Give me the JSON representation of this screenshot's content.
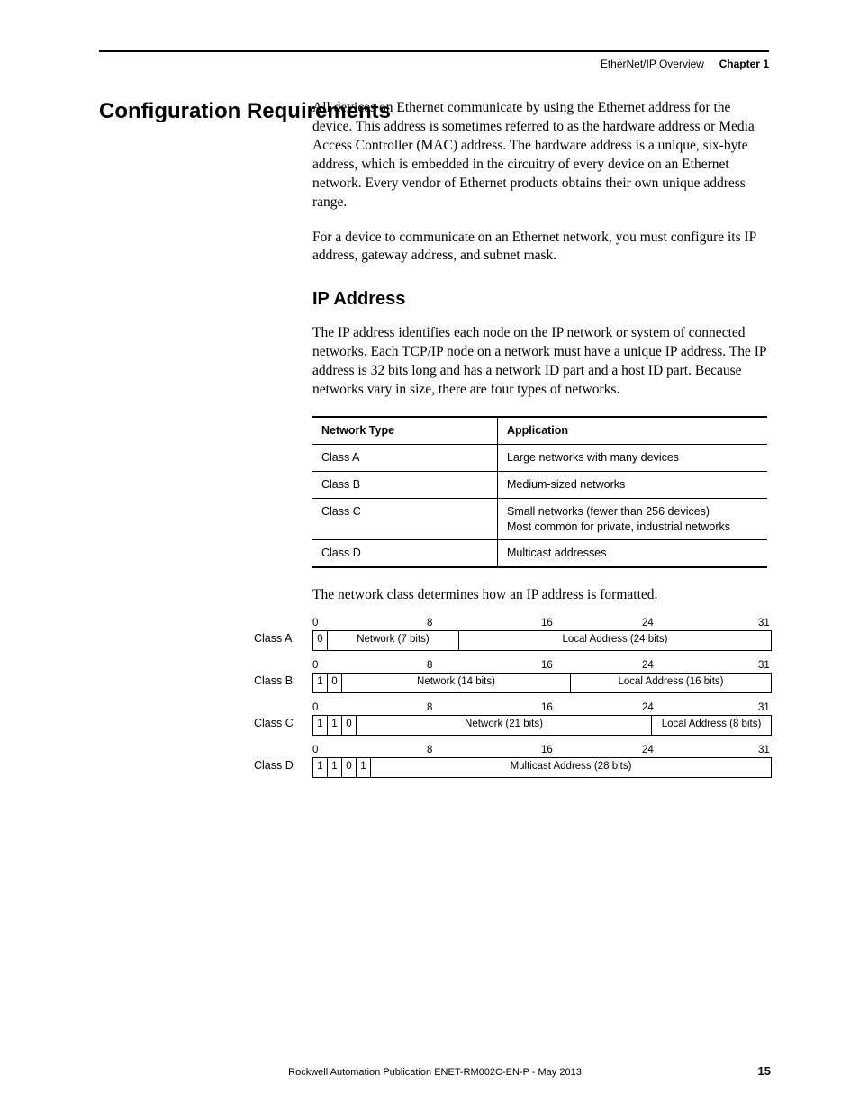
{
  "header": {
    "doc_title": "EtherNet/IP Overview",
    "chapter": "Chapter 1"
  },
  "section_heading": "Configuration Requirements",
  "p1": "All devices on Ethernet communicate by using the Ethernet address for the device. This address is sometimes referred to as the hardware address or Media Access Controller (MAC) address. The hardware address is a unique, six-byte address, which is embedded in the circuitry of every device on an Ethernet network. Every vendor of Ethernet products obtains their own unique address range.",
  "p2": "For a device to communicate on an Ethernet network, you must configure its IP address, gateway address, and subnet mask.",
  "subhead": "IP Address",
  "p3": "The IP address identifies each node on the IP network or system of connected networks. Each TCP/IP node on a network must have a unique IP address. The IP address is 32 bits long and has a network ID part and a host ID part. Because networks vary in size, there are four types of networks.",
  "table": {
    "headers": {
      "c1": "Network Type",
      "c2": "Application"
    },
    "rows": [
      {
        "c1": "Class A",
        "c2": "Large networks with many devices"
      },
      {
        "c1": "Class B",
        "c2": "Medium-sized networks"
      },
      {
        "c1": "Class C",
        "c2": "Small networks (fewer than 256 devices)\nMost common for private, industrial networks"
      },
      {
        "c1": "Class D",
        "c2": "Multicast addresses"
      }
    ]
  },
  "p4": "The network class determines how an IP address is formatted.",
  "ticks": {
    "t0": "0",
    "t8": "8",
    "t16": "16",
    "t24": "24",
    "t31": "31"
  },
  "diag": {
    "a": {
      "label": "Class A",
      "b0": "0",
      "net": "Network (7 bits)",
      "local": "Local Address (24 bits)"
    },
    "b": {
      "label": "Class B",
      "b0": "1",
      "b1": "0",
      "net": "Network (14 bits)",
      "local": "Local Address (16 bits)"
    },
    "c": {
      "label": "Class C",
      "b0": "1",
      "b1": "1",
      "b2": "0",
      "net": "Network (21 bits)",
      "local": "Local Address (8 bits)"
    },
    "d": {
      "label": "Class D",
      "b0": "1",
      "b1": "1",
      "b2": "0",
      "b3": "1",
      "mc": "Multicast Address (28 bits)"
    }
  },
  "footer": {
    "text": "Rockwell Automation Publication ENET-RM002C-EN-P - May 2013",
    "page": "15"
  }
}
